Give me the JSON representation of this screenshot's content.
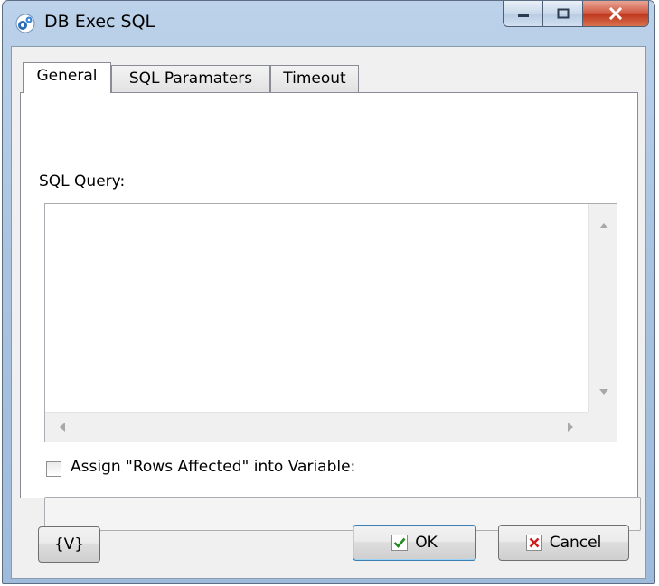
{
  "window": {
    "title": "DB Exec SQL",
    "app_icon": "gears-icon",
    "controls": [
      "minimize-icon",
      "maximize-icon",
      "close-icon"
    ]
  },
  "tabs": [
    {
      "label": "General",
      "active": true
    },
    {
      "label": "SQL Paramaters",
      "active": false
    },
    {
      "label": "Timeout",
      "active": false
    }
  ],
  "general": {
    "sql_query_label": "SQL Query:",
    "sql_query_value": "",
    "assign_checkbox_label": "Assign \"Rows Affected\" into Variable:",
    "assign_checked": false,
    "variable_value": ""
  },
  "buttons": {
    "variables_label": "{V}",
    "ok_label": "OK",
    "cancel_label": "Cancel"
  },
  "colors": {
    "frame": "#a9c3e0",
    "ok_check": "#1e8c1e",
    "cancel_x": "#d11c1c",
    "close_button": "#c74a30"
  }
}
